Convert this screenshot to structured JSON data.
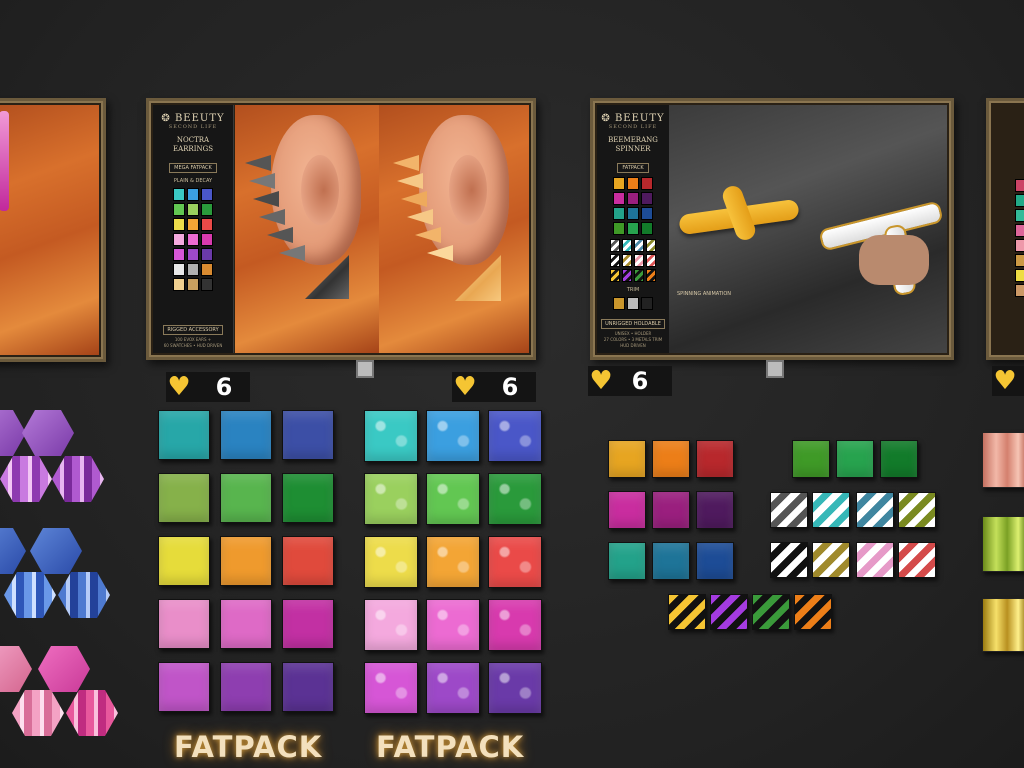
{
  "boards": {
    "noctra": {
      "logo": "BEEUTY",
      "logo_sub": "SECOND LIFE",
      "title_line1": "NOCTRA",
      "title_line2": "EARRINGS",
      "tag": "MEGA FATPACK",
      "subtitle": "PLAIN & DECAY",
      "footer_tag": "RIGGED ACCESSORY",
      "footer_line1": "100 EVOX EARS +",
      "footer_line2": "60 SWATCHES • HUD DRIVEN"
    },
    "beemerang": {
      "logo": "BEEUTY",
      "logo_sub": "SECOND LIFE",
      "title_line1": "BEEMERANG",
      "title_line2": "SPINNER",
      "tag": "FATPACK",
      "subtitle": "TRIM",
      "animation_label": "SPINNING ANIMATION",
      "footer_tag": "UNRIGGED HOLDABLE",
      "footer_line1": "UNISEX • HOLDER",
      "footer_line2": "27 COLORS • 3 METALS TRIM",
      "footer_line3": "HUD DRIVEN"
    }
  },
  "prices": [
    {
      "value": "6",
      "icon": "heart-icon"
    },
    {
      "value": "6",
      "icon": "heart-icon"
    },
    {
      "value": "6",
      "icon": "heart-icon"
    },
    {
      "value": "",
      "icon": "heart-icon"
    }
  ],
  "labels": {
    "fatpack_1": "FATPACK",
    "fatpack_2": "FATPACK"
  },
  "colors": {
    "plain_swatches": [
      "#27a7a8",
      "#2a83c1",
      "#3c4fa6",
      "#86b14a",
      "#58b54e",
      "#1e8e33",
      "#e6dc3a",
      "#ef9a2d",
      "#e04a3c",
      "#e98ec9",
      "#de6ac6",
      "#c230a3",
      "#c055c8",
      "#8e3eb0",
      "#5b3294"
    ],
    "decay_swatches": [
      "#3ac9c4",
      "#3b9fe0",
      "#4a57c8",
      "#9ad05e",
      "#62c752",
      "#2a9a3b",
      "#eddc4a",
      "#f3a535",
      "#ea4a48",
      "#f4a9de",
      "#ec6bd2",
      "#d83aae",
      "#d656d6",
      "#9d49c8",
      "#6a3aa8"
    ],
    "spinner_colors": [
      "#e7a521",
      "#ec7e18",
      "#b8282c",
      "#c92d9f",
      "#9a1f7e",
      "#4f1a5e",
      "#23a28a",
      "#1e7498",
      "#1d4c96"
    ],
    "spinner_greens": [
      "#3f9a27",
      "#27a34e",
      "#127b2a"
    ],
    "accent": "#f5c533"
  }
}
